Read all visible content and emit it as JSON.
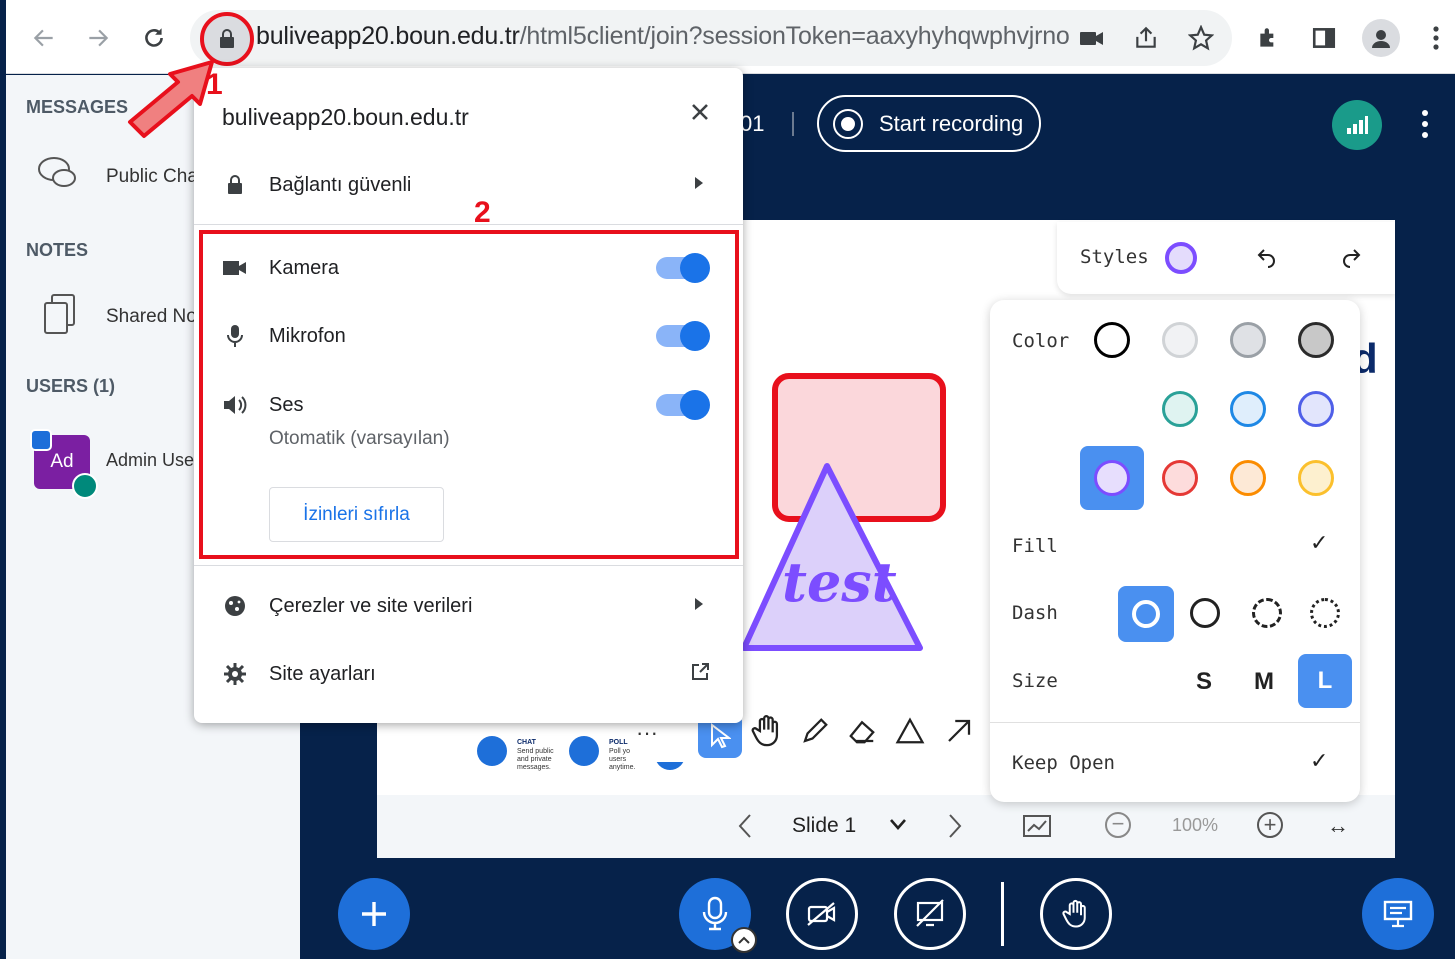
{
  "browser": {
    "url_host": "buliveapp20.boun.edu.tr",
    "url_path": "/html5client/join?sessionToken=aaxyhyhqwphvjrno"
  },
  "annotations": {
    "marker_1": "1",
    "marker_2": "2"
  },
  "sidebar": {
    "messages_title": "MESSAGES",
    "public_chat": "Public Cha",
    "notes_title": "NOTES",
    "shared_notes": "Shared No",
    "users_title": "USERS (1)",
    "avatar_initials": "Ad",
    "admin_user": "Admin Use"
  },
  "topbar": {
    "meeting_fragment": "01",
    "start_recording": "Start recording"
  },
  "popup": {
    "site": "buliveapp20.boun.edu.tr",
    "connection": "Bağlantı güvenli",
    "camera": "Kamera",
    "microphone": "Mikrofon",
    "sound": "Ses",
    "sound_sub": "Otomatik (varsayılan)",
    "reset_button": "İzinleri sıfırla",
    "cookies": "Çerezler ve site verileri",
    "site_settings": "Site ayarları",
    "camera_enabled": true,
    "microphone_enabled": true,
    "sound_enabled": true
  },
  "whiteboard": {
    "styles_label": "Styles",
    "color_label": "Color",
    "fill_label": "Fill",
    "dash_label": "Dash",
    "size_label": "Size",
    "size_s": "S",
    "size_m": "M",
    "size_l": "L",
    "keep_open": "Keep Open",
    "shape_text": "test",
    "colors": [
      "#000000",
      "#d0d3d6",
      "#9aa0a6",
      "#2b2b2b",
      "#3ca553",
      "#2aa198",
      "#1e88e5",
      "#4f5fe8",
      "#7c4dff",
      "#e53935",
      "#fb8c00",
      "#fbc02d"
    ],
    "selected_color": "#7c4dff"
  },
  "slide_nav": {
    "slide_label": "Slide 1",
    "zoom": "100%"
  },
  "mini_slide": {
    "chat_title": "CHAT",
    "chat_desc": "Send public and private messages.",
    "poll_title": "POLL",
    "poll_desc": "Poll your users anytime."
  }
}
